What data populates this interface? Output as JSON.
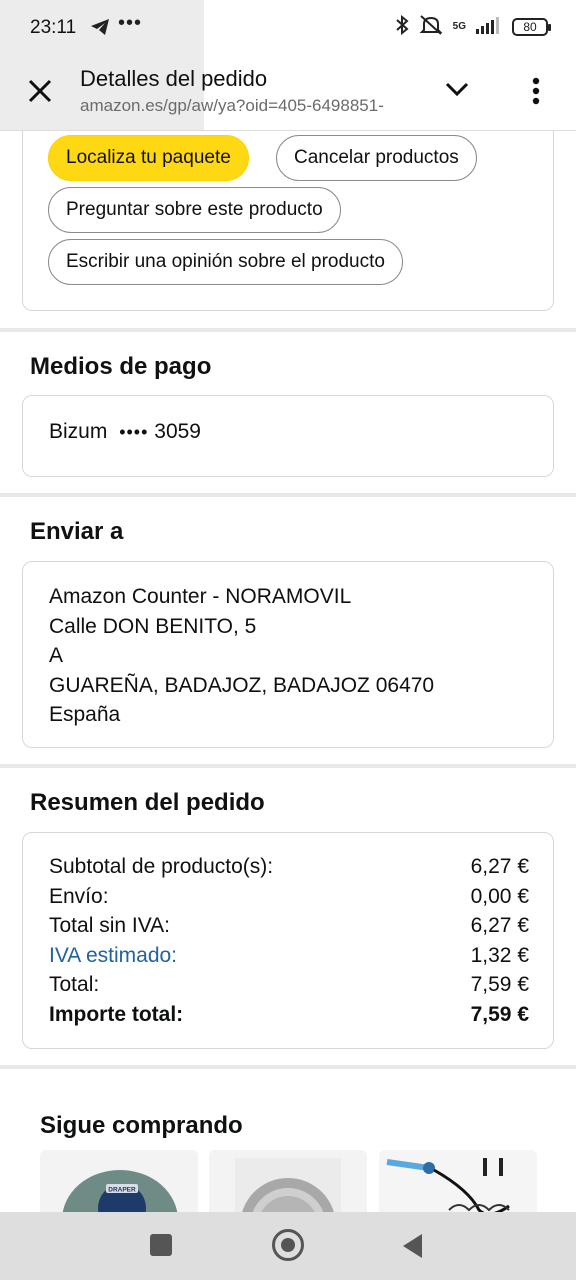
{
  "status_bar": {
    "time": "23:11",
    "more": "•••",
    "network": "5G",
    "battery": "80"
  },
  "app_bar": {
    "title": "Detalles del pedido",
    "url": "amazon.es/gp/aw/ya?oid=405-6498851-"
  },
  "actions": {
    "track": "Localiza tu paquete",
    "cancel": "Cancelar productos",
    "ask": "Preguntar sobre este producto",
    "review": "Escribir una opinión sobre el producto"
  },
  "payment": {
    "title": "Medios de pago",
    "method": "Bizum",
    "mask": "••••",
    "last4": "3059"
  },
  "shipping": {
    "title": "Enviar a",
    "lines": [
      "Amazon Counter - NORAMOVIL",
      "Calle DON BENITO, 5",
      "A",
      "GUAREÑA, BADAJOZ, BADAJOZ 06470",
      "España"
    ]
  },
  "summary": {
    "title": "Resumen del pedido",
    "rows": [
      {
        "label": "Subtotal de producto(s):",
        "value": "6,27 €"
      },
      {
        "label": "Envío:",
        "value": "0,00 €"
      },
      {
        "label": "Total sin IVA:",
        "value": "6,27 €"
      },
      {
        "label": "IVA estimado:",
        "value": "1,32 €"
      },
      {
        "label": "Total:",
        "value": "7,59 €"
      },
      {
        "label": "Importe total:",
        "value": "7,59 €"
      }
    ]
  },
  "keep_shopping": {
    "title": "Sigue comprando",
    "brand_badge": "DRAPER"
  },
  "colors": {
    "primary_button": "#ffd814",
    "link": "#2162a1",
    "border": "#d5d9d9"
  }
}
